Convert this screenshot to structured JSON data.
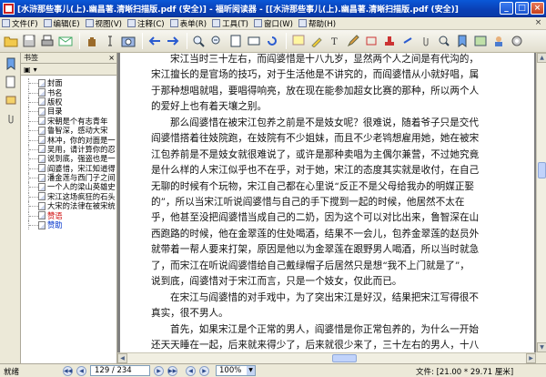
{
  "window": {
    "title": "[水浒那些事儿(上).幽昌著.清晰扫描版.pdf (安全)] - 福昕阅读器 - [[水浒那些事儿(上).幽昌著.清晰扫描版.pdf (安全)]",
    "minimize": "_",
    "maximize": "□",
    "close": "×"
  },
  "menu": {
    "items": [
      "文件(F)",
      "编辑(E)",
      "视图(V)",
      "注释(C)",
      "表单(R)",
      "工具(T)",
      "窗口(W)",
      "帮助(H)"
    ],
    "doc_close": "×"
  },
  "bookmarks": {
    "header": "书签",
    "close": "×",
    "tool1": "▣",
    "tool2": "▾",
    "items": [
      {
        "label": "封面",
        "style": ""
      },
      {
        "label": "书名",
        "style": ""
      },
      {
        "label": "版权",
        "style": ""
      },
      {
        "label": "目录",
        "style": ""
      },
      {
        "label": "宋朝是个有志青年",
        "style": ""
      },
      {
        "label": "鲁智深，感动大宋",
        "style": ""
      },
      {
        "label": "林冲，你的对面是一",
        "style": ""
      },
      {
        "label": "吴用，请计算你的忍",
        "style": ""
      },
      {
        "label": "说到底，强盗也是一",
        "style": ""
      },
      {
        "label": "阎婆惜，宋江知道得",
        "style": ""
      },
      {
        "label": "潘金莲与西门子之间",
        "style": ""
      },
      {
        "label": "一个人的梁山英雄史",
        "style": ""
      },
      {
        "label": "宋江这场疯狂的石头",
        "style": ""
      },
      {
        "label": "大宋的法律在被宋统",
        "style": ""
      },
      {
        "label": "赞语",
        "style": "red"
      },
      {
        "label": "赞助",
        "style": "blue"
      }
    ]
  },
  "document": {
    "paragraphs": [
      [
        "宋江当时三十左右，而阎婆惜是十八九岁，显然两个人之间是有代沟的，",
        "宋江擅长的是官场的技巧，对于生活他是不讲究的，而阎婆惜从小就好唱，属",
        "于那种想唱就唱，要唱得响亮，放在现在能参加超女比赛的那种，所以两个人",
        "的爱好上也有着天壤之别。"
      ],
      [
        "那么阎婆惜在被宋江包养之前是不是妓女呢？很难说，随着爷子只是交代",
        "阎婆惜搭着往妓院跑，在妓院有不少姐妹，而且不少老鸨想雇用她，她在被宋",
        "江包养前是不是妓女就很难说了，或许是那种卖唱为主偶尔兼营，不过她究竟",
        "是什么样的人宋江似乎也不在乎，对于她，宋江的态度其实就是收付，在自己",
        "无聊的时候有个玩物，宋江自己都在心里说“反正不是父母给我办的明媒正娶",
        "的”，所以当宋江听说阎婆惜与自己的手下搅到一起的时候，他居然不太在",
        "乎，他甚至没把阎婆惜当成自己的二奶，因为这个可以对比出来，鲁智深在山",
        "西跑路的时候，他在金翠莲的住处喝酒，结果不一会儿，包养金翠莲的赵员外",
        "就带着一帮人要来打架，原因是他以为金翠莲在跟野男人喝酒，所以当时就急",
        "了，而宋江在听说阎婆惜给自己戴绿帽子后居然只是想“我不上门就是了”，",
        "说到底，阎婆惜对于宋江而言，只是一个妓女，仅此而已。"
      ],
      [
        "在宋江与阎婆惜的对手戏中，为了突出宋江是好汉，结果把宋江写得很不",
        "真实，很不男人。"
      ],
      [
        "首先，如果宋江是个正常的男人，阎婆惜是你正常包养的，为什么一开始",
        "还天天睡在一起，后来就来得少了，后来就很少来了，三十左右的男人，十八"
      ]
    ]
  },
  "status": {
    "ready": "就绪",
    "first": "◀◀",
    "prev": "◀",
    "page": "129 / 234",
    "next": "▶",
    "last": "▶▶",
    "back": "◀",
    "forward": "▶",
    "zoom": "100%",
    "zoom_dropdown": "▼",
    "page_size": "文件: [21.00 * 29.71 厘米]"
  },
  "scroll": {
    "up": "▲",
    "down": "▼",
    "left": "◀",
    "right": "▶"
  },
  "icons": {
    "app": "foxit-icon",
    "open": "folder-open-icon",
    "save": "save-icon",
    "print": "printer-icon",
    "email": "email-icon",
    "hand": "hand-tool-icon",
    "select": "text-select-icon",
    "snapshot": "snapshot-icon",
    "back": "back-arrow-icon",
    "forward": "forward-arrow-icon",
    "zoom_in": "zoom-in-icon",
    "zoom_out": "zoom-out-icon",
    "rotate": "rotate-icon"
  }
}
